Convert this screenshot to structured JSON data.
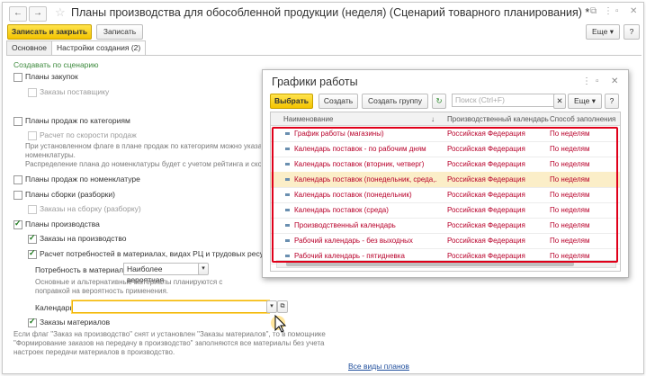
{
  "window": {
    "title": "Планы производства для обособленной продукции (неделя) (Сценарий товарного планирования) *",
    "back_icon": "←",
    "forward_icon": "→",
    "star_icon": "☆",
    "top_icons": [
      "⧉",
      "⋮",
      "▫",
      "✕"
    ]
  },
  "toolbar": {
    "save_close_label": "Записать и закрыть",
    "save_label": "Записать",
    "more_label": "Еще",
    "help_label": "?"
  },
  "tabs": [
    {
      "label": "Основное"
    },
    {
      "label": "Настройки создания (2)"
    }
  ],
  "form": {
    "create_by_scenario": "Создавать по сценарию",
    "plans_purchase": "Планы закупок",
    "supplier_orders": "Заказы поставщику",
    "plans_sales_category": "Планы продаж по категориям",
    "calc_by_sales_speed": "Расчет по скорости продаж",
    "category_hint": "При установленном флаге в плане продаж по категориям можно указать ре\nноменклатуры.\nРаспределение плана до номенклатуры будет с учетом рейтинга и скорост",
    "plans_sales_nomenclature": "Планы продаж по номенклатуре",
    "plans_assembly": "Планы сборки (разборки)",
    "assembly_orders": "Заказы на сборку (разборку)",
    "plans_production": "Планы производства",
    "production_orders": "Заказы на производство",
    "calc_needs": "Расчет потребностей в материалах, видах РЦ и трудовых ресурсах",
    "material_need_label": "Потребность в материалах:",
    "material_need_value": "Наиболее вероятная",
    "material_hint": "Основные и альтернативные материалы планируются с\nпоправкой на вероятность применения.",
    "calendar_label": "Календарь:",
    "calendar_value": "",
    "material_orders": "Заказы материалов",
    "bottom_hint": "Если флаг \"Заказ на производство\" снят и установлен \"Заказы материалов\", то в помощнике\n\"Формирование заказов на передачу в производство\" заполняются все материалы без учета\nнастроек передачи материалов в производство.",
    "all_plan_types_link": "Все виды планов"
  },
  "dialog": {
    "title": "Графики работы",
    "select_label": "Выбрать",
    "create_label": "Создать",
    "create_group_label": "Создать группу",
    "search_placeholder": "Поиск (Ctrl+F)",
    "more_label": "Еще",
    "help_label": "?",
    "title_icons": [
      "⋮",
      "▫",
      "✕"
    ],
    "columns": [
      "Наименование",
      "Производственный календарь",
      "Способ заполнения"
    ],
    "rows": [
      {
        "name": "График работы (магазины)",
        "calendar": "Российская Федерация",
        "fill": "По неделям"
      },
      {
        "name": "Календарь поставок - по рабочим дням",
        "calendar": "Российская Федерация",
        "fill": "По неделям"
      },
      {
        "name": "Календарь поставок (вторник, четверг)",
        "calendar": "Российская Федерация",
        "fill": "По неделям"
      },
      {
        "name": "Календарь поставок (понедельник, среда,...",
        "calendar": "Российская Федерация",
        "fill": "По неделям"
      },
      {
        "name": "Календарь поставок (понедельник)",
        "calendar": "Российская Федерация",
        "fill": "По неделям"
      },
      {
        "name": "Календарь поставок (среда)",
        "calendar": "Российская Федерация",
        "fill": "По неделям"
      },
      {
        "name": "Производственный календарь",
        "calendar": "Российская Федерация",
        "fill": "По неделям"
      },
      {
        "name": "Рабочий календарь - без выходных",
        "calendar": "Российская Федерация",
        "fill": "По неделям"
      },
      {
        "name": "Рабочий календарь - пятидневка",
        "calendar": "Российская Федерация",
        "fill": "По неделям"
      }
    ]
  },
  "colors": {
    "accent": "#f4c400",
    "highlight": "#e0001a",
    "row_text": "#b8002a"
  }
}
